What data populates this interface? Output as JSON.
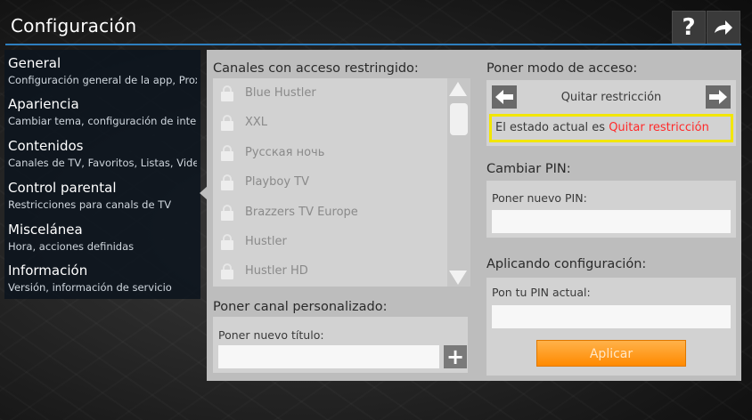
{
  "header": {
    "title": "Configuración",
    "help_icon": "?",
    "share_icon": "➜"
  },
  "sidebar": {
    "items": [
      {
        "title": "General",
        "subtitle": "Configuración general de la app, Proxy U"
      },
      {
        "title": "Apariencia",
        "subtitle": "Cambiar tema, configuración de interfaz"
      },
      {
        "title": "Contenidos",
        "subtitle": "Canales de TV, Favoritos, Listas, Video"
      },
      {
        "title": "Control parental",
        "subtitle": "Restricciones para canals de TV"
      },
      {
        "title": "Miscelánea",
        "subtitle": "Hora, acciones definidas"
      },
      {
        "title": "Información",
        "subtitle": "Versión, información de servicio"
      }
    ],
    "selected": "Control parental"
  },
  "restricted": {
    "label": "Canales con acceso restringido:",
    "channels": [
      "Blue Hustler",
      "XXL",
      "Русская ночь",
      "Playboy TV",
      "Brazzers TV Europe",
      "Hustler",
      "Hustler HD"
    ]
  },
  "custom_channel": {
    "label": "Poner canal personalizado:",
    "field_label": "Poner nuevo título:",
    "value": "",
    "add_icon": "+"
  },
  "access_mode": {
    "label": "Poner modo de acceso:",
    "value": "Quitar restricción",
    "status_prefix": "El estado actual es",
    "status_value": "Quitar restricción"
  },
  "change_pin": {
    "label": "Cambiar PIN:",
    "field_label": "Poner nuevo PIN:",
    "value": ""
  },
  "apply": {
    "label": "Aplicando configuración:",
    "field_label": "Pon tu PIN actual:",
    "value": "",
    "button": "Aplicar"
  },
  "colors": {
    "accent_line": "#2e7fbf",
    "highlight_border": "#f2e600",
    "status_red": "#ff2a2a",
    "apply_button": "#ff9a1a"
  }
}
